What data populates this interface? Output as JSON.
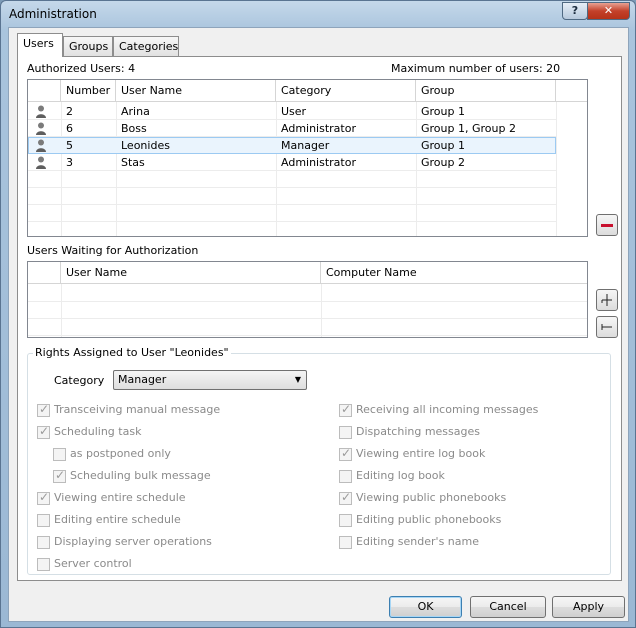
{
  "window": {
    "title": "Administration",
    "help_label": "?",
    "close_label": "✕"
  },
  "tabs": [
    {
      "label": "Users",
      "active": true
    },
    {
      "label": "Groups",
      "active": false
    },
    {
      "label": "Categories",
      "active": false
    }
  ],
  "authorized": {
    "label": "Authorized Users: 4",
    "max_label": "Maximum number of users: 20",
    "columns": [
      "",
      "Number",
      "User Name",
      "Category",
      "Group"
    ],
    "rows": [
      {
        "number": "2",
        "name": "Arina",
        "category": "User",
        "group": "Group 1",
        "selected": false
      },
      {
        "number": "6",
        "name": "Boss",
        "category": "Administrator",
        "group": "Group 1, Group 2",
        "selected": false
      },
      {
        "number": "5",
        "name": "Leonides",
        "category": "Manager",
        "group": "Group 1",
        "selected": true
      },
      {
        "number": "3",
        "name": "Stas",
        "category": "Administrator",
        "group": "Group 2",
        "selected": false
      }
    ]
  },
  "waiting": {
    "label": "Users Waiting for Authorization",
    "columns": [
      "",
      "User Name",
      "Computer Name"
    ]
  },
  "rights": {
    "title": "Rights Assigned to User \"Leonides\"",
    "category_label": "Category",
    "category_value": "Manager",
    "left": [
      {
        "label": "Transceiving manual message",
        "checked": true
      },
      {
        "label": "Scheduling task",
        "checked": true
      },
      {
        "label": "as postponed only",
        "checked": false
      },
      {
        "label": "Scheduling bulk message",
        "checked": true
      },
      {
        "label": "Viewing entire schedule",
        "checked": true
      },
      {
        "label": "Editing entire schedule",
        "checked": false
      },
      {
        "label": "Displaying server operations",
        "checked": false
      },
      {
        "label": "Server control",
        "checked": false
      }
    ],
    "right": [
      {
        "label": "Receiving all incoming messages",
        "checked": true
      },
      {
        "label": "Dispatching messages",
        "checked": false
      },
      {
        "label": "Viewing entire log book",
        "checked": true
      },
      {
        "label": "Editing log book",
        "checked": false
      },
      {
        "label": "Viewing public phonebooks",
        "checked": true
      },
      {
        "label": "Editing public phonebooks",
        "checked": false
      },
      {
        "label": "Editing sender's name",
        "checked": false
      }
    ]
  },
  "buttons": {
    "ok": "OK",
    "cancel": "Cancel",
    "apply": "Apply"
  },
  "colors": {
    "accent": "#3c7fb1",
    "remove": "#c8102e",
    "selection": "#eaf4fd"
  }
}
